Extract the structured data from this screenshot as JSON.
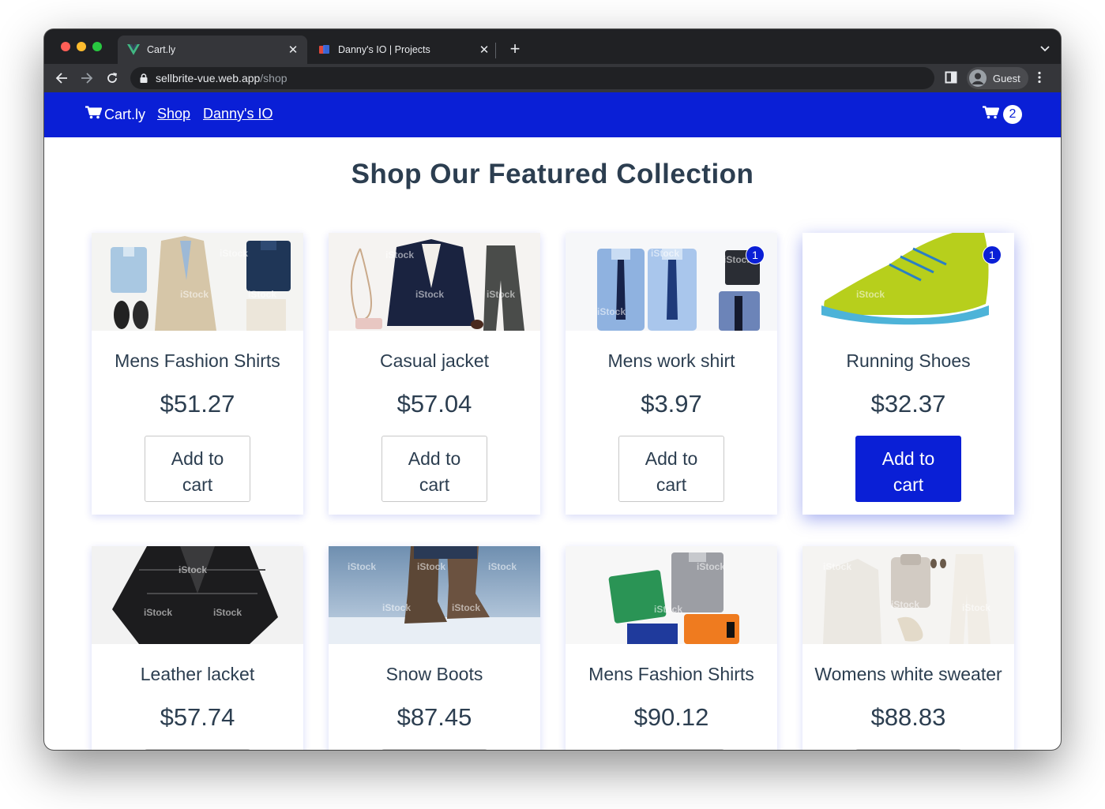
{
  "browser": {
    "tabs": [
      {
        "title": "Cart.ly",
        "active": true
      },
      {
        "title": "Danny's IO | Projects",
        "active": false
      }
    ],
    "url_domain": "sellbrite-vue.web.app",
    "url_path": "/shop",
    "profile_label": "Guest"
  },
  "site": {
    "brand": "Cart.ly",
    "nav_links": [
      "Shop",
      "Danny's IO"
    ],
    "cart_count": "2",
    "accent_color": "#0a1fd6"
  },
  "main": {
    "heading": "Shop Our Featured Collection",
    "add_label_line1": "Add to",
    "add_label_line2": "cart",
    "products": [
      {
        "name": "Mens Fashion Shirts",
        "price": "$51.27",
        "image": "mens-outfit-flatlay",
        "qty": ""
      },
      {
        "name": "Casual jacket",
        "price": "$57.04",
        "image": "casual-jacket-flatlay",
        "qty": ""
      },
      {
        "name": "Mens work shirt",
        "price": "$3.97",
        "image": "dress-shirts-ties",
        "qty": "1"
      },
      {
        "name": "Running Shoes",
        "price": "$32.37",
        "image": "green-running-shoe",
        "qty": "1"
      },
      {
        "name": "Leather lacket",
        "price": "$57.74",
        "image": "black-leather-jacket",
        "qty": ""
      },
      {
        "name": "Snow Boots",
        "price": "$87.45",
        "image": "snow-boots",
        "qty": ""
      },
      {
        "name": "Mens Fashion Shirts",
        "price": "$90.12",
        "image": "polo-shirts-flatlay",
        "qty": ""
      },
      {
        "name": "Womens white sweater",
        "price": "$88.83",
        "image": "white-outfit-flatlay",
        "qty": ""
      }
    ]
  }
}
